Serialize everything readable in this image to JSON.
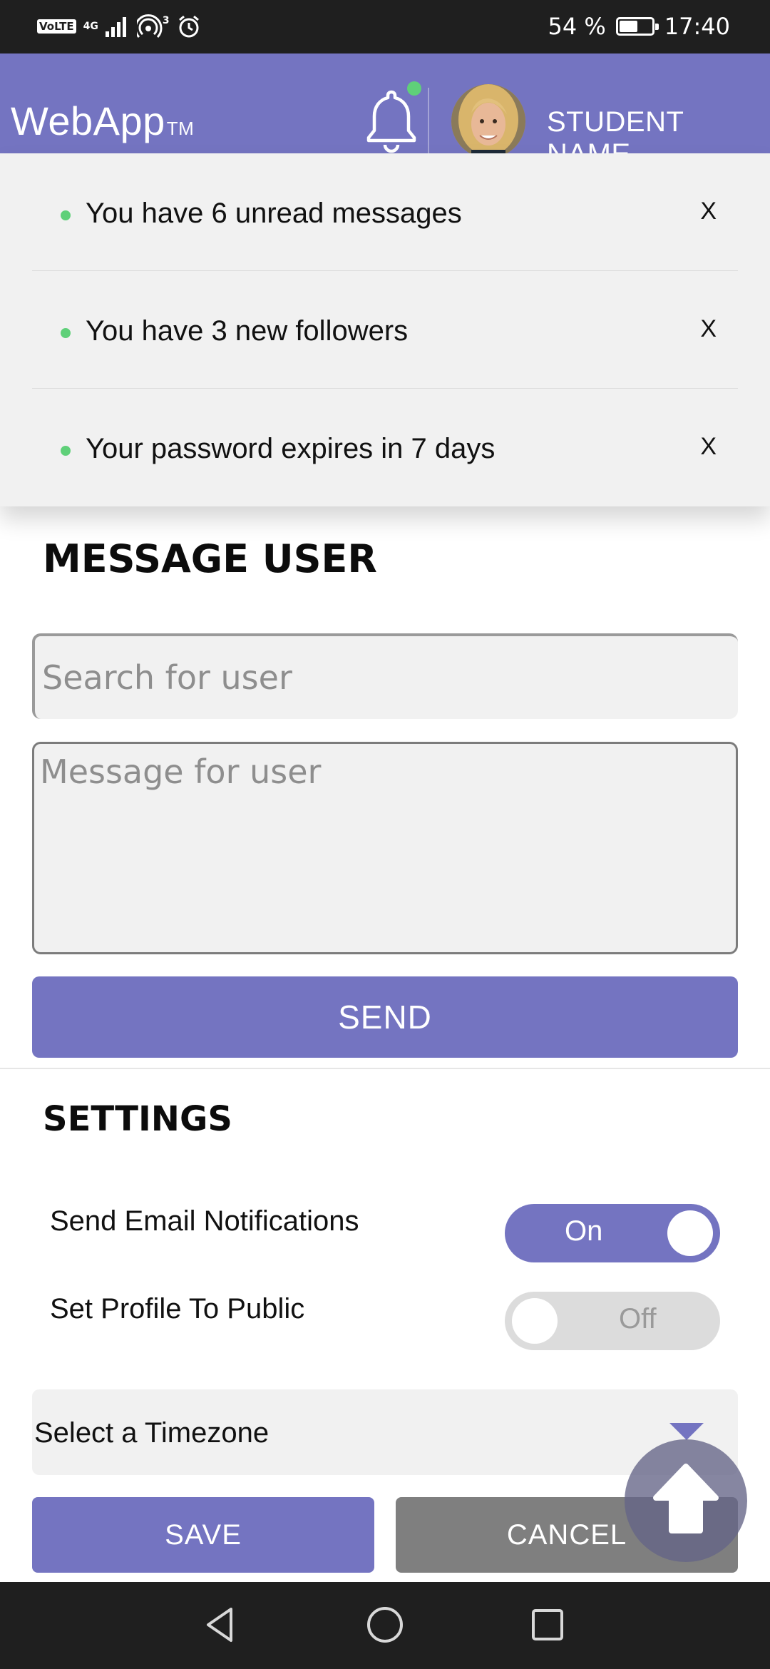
{
  "status_bar": {
    "volte": "VoLTE",
    "network": "4G",
    "hotspot_count": "3",
    "battery": "54 %",
    "battery_level": 0.54,
    "time": "17:40",
    "icons": [
      "signal-icon",
      "hotspot-icon",
      "alarm-icon",
      "battery-icon"
    ]
  },
  "header": {
    "logo": "WebApp",
    "logo_mark": "TM",
    "user_name": "STUDENT NAME",
    "has_unread": true,
    "accent_color": "#7474c1"
  },
  "notifications": [
    {
      "text": "You have 6 unread messages",
      "close_label": "X"
    },
    {
      "text": "You have 3 new followers",
      "close_label": "X"
    },
    {
      "text": "Your password expires in 7 days",
      "close_label": "X"
    }
  ],
  "message_user": {
    "title": "MESSAGE USER",
    "search_placeholder": "Search for user",
    "message_placeholder": "Message for user",
    "send_label": "SEND"
  },
  "settings": {
    "title": "SETTINGS",
    "email_notifications": {
      "label": "Send Email Notifications",
      "state_label": "On",
      "enabled": true
    },
    "public_profile": {
      "label": "Set Profile To Public",
      "state_label": "Off",
      "enabled": false
    },
    "timezone_placeholder": "Select a Timezone",
    "save_label": "SAVE",
    "cancel_label": "CANCEL"
  },
  "nav": {
    "icons": [
      "back-icon",
      "home-icon",
      "recents-icon"
    ]
  }
}
